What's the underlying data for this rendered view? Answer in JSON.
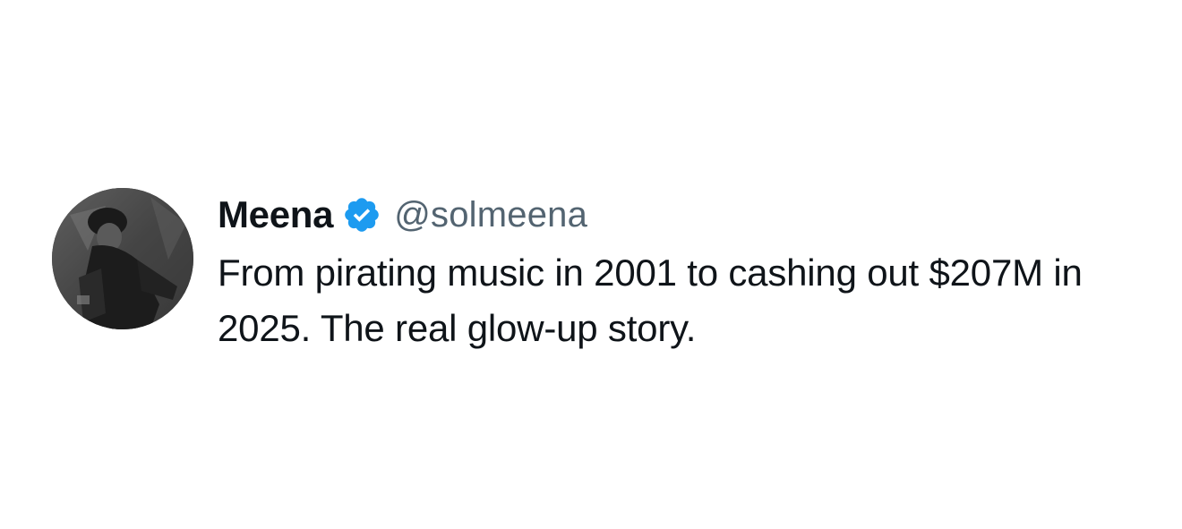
{
  "tweet": {
    "author_name": "Meena",
    "verified": true,
    "handle": "@solmeena",
    "text": "From pirating music in 2001 to cashing out $207M in 2025. The real glow-up story."
  },
  "icons": {
    "avatar": "profile-photo",
    "badge": "verified-badge-icon"
  },
  "colors": {
    "text": "#0f1419",
    "handle": "#536471",
    "verified": "#1d9bf0",
    "background": "#ffffff"
  }
}
